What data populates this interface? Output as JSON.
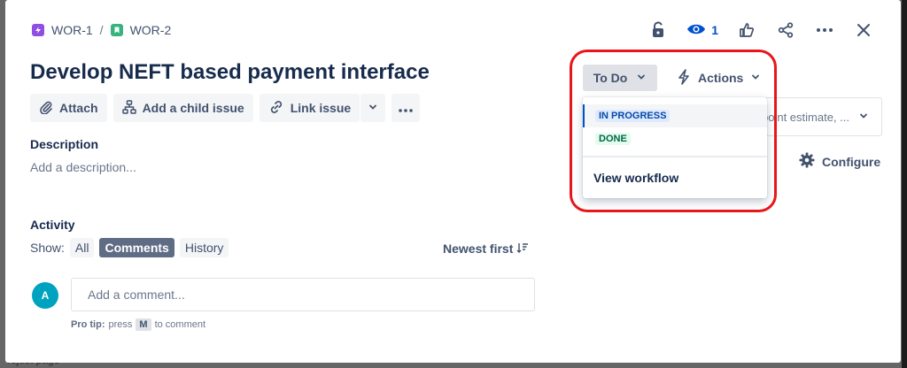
{
  "backdrop": {
    "text": "rojost page"
  },
  "breadcrumb": {
    "parent": "WOR-1",
    "separator": "/",
    "current": "WOR-2"
  },
  "header": {
    "watch_count": "1"
  },
  "issue": {
    "title": "Develop NEFT based payment interface"
  },
  "toolbar": {
    "attach": "Attach",
    "add_child": "Add a child issue",
    "link_issue": "Link issue"
  },
  "description": {
    "label": "Description",
    "placeholder": "Add a description..."
  },
  "activity": {
    "label": "Activity",
    "show_label": "Show:",
    "filters": [
      "All",
      "Comments",
      "History"
    ],
    "active_filter": "Comments",
    "sort": "Newest first"
  },
  "comment": {
    "avatar_initial": "A",
    "placeholder": "Add a comment...",
    "protip_prefix": "Pro tip:",
    "protip_press": "press",
    "protip_key": "M",
    "protip_suffix": "to comment"
  },
  "status": {
    "current": "To Do",
    "actions_label": "Actions"
  },
  "status_menu": {
    "items": [
      {
        "label": "IN PROGRESS",
        "color": "#0747a6"
      },
      {
        "label": "DONE",
        "color": "#006644"
      }
    ],
    "view_workflow": "View workflow"
  },
  "details": {
    "partial_text": "point estimate, ..."
  },
  "configure": {
    "label": "Configure"
  }
}
